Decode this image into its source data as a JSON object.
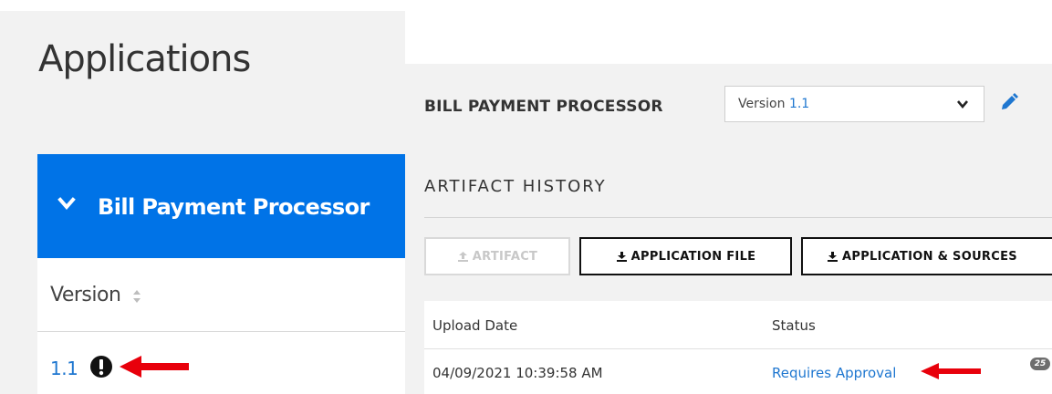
{
  "left": {
    "title": "Applications",
    "app_name": "Bill Payment Processor",
    "version_column_label": "Version",
    "version_link": "1.1"
  },
  "right": {
    "app_name": "BILL PAYMENT PROCESSOR",
    "version_select": {
      "prefix": "Version",
      "value": "1.1"
    },
    "section_title": "ARTIFACT HISTORY",
    "buttons": {
      "artifact": "ARTIFACT",
      "application_file": "APPLICATION FILE",
      "application_sources": "APPLICATION & SOURCES"
    },
    "table": {
      "headers": [
        "Upload Date",
        "Status"
      ],
      "rows": [
        {
          "upload_date": "04/09/2021 10:39:58 AM",
          "status": "Requires Approval",
          "badge": "25"
        }
      ]
    }
  },
  "colors": {
    "accent_blue": "#0073e7",
    "link_blue": "#1f77d0",
    "arrow_red": "#e8000b",
    "panel_bg": "#f2f2f2"
  },
  "icons": [
    "chevron-down-icon",
    "sort-icon",
    "alert-icon",
    "arrow-icon",
    "chevron-down-icon",
    "pencil-icon",
    "upload-icon",
    "download-icon"
  ]
}
